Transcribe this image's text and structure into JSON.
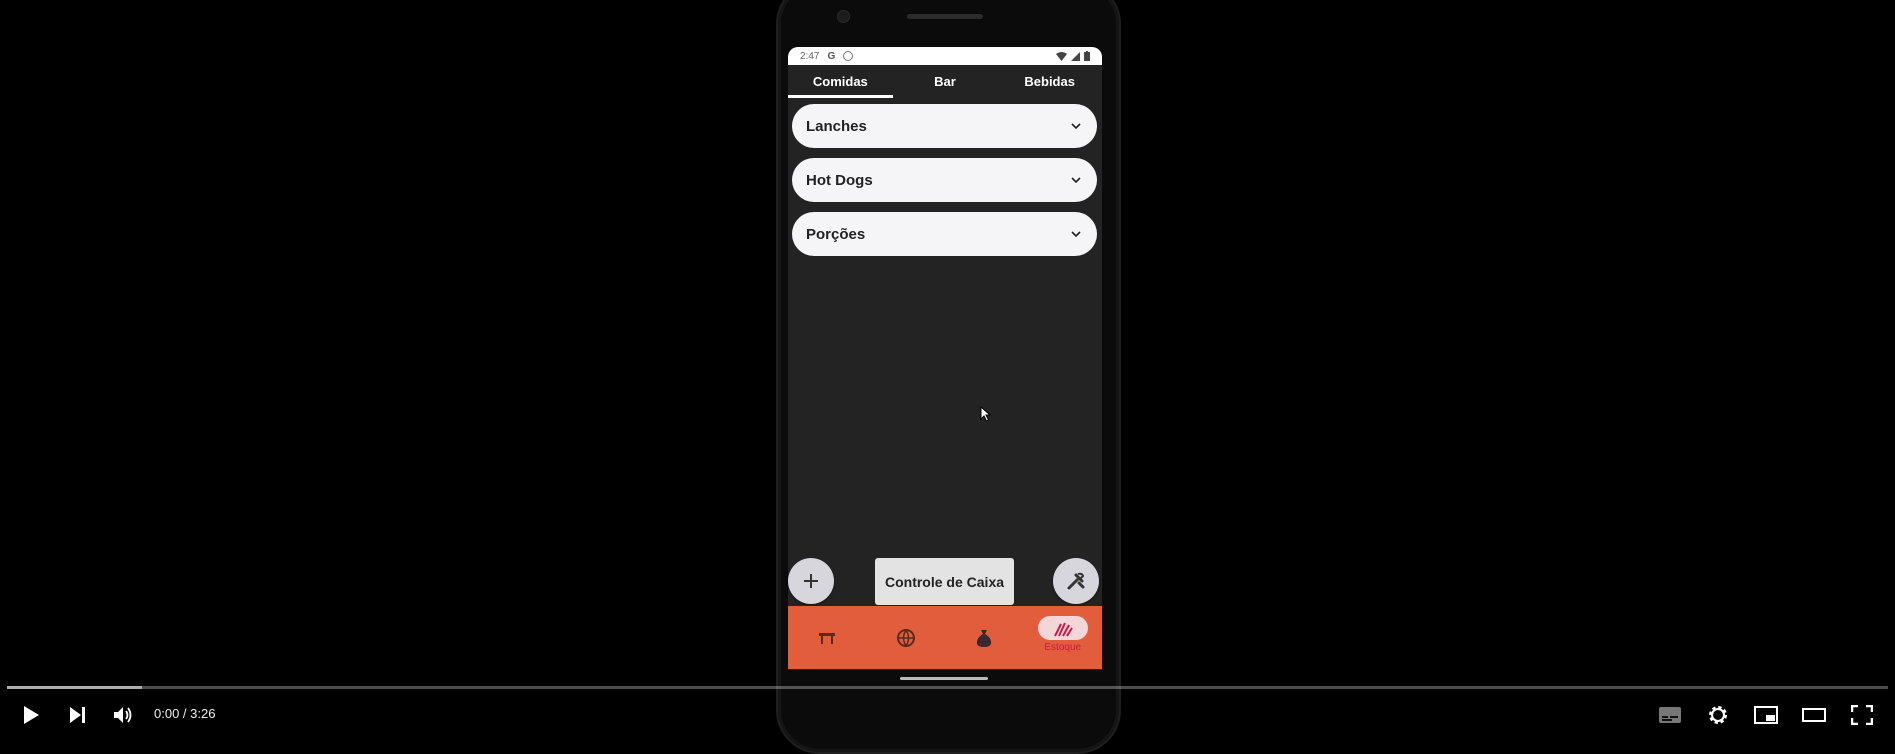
{
  "status_bar": {
    "time": "2:47",
    "g_icon": "google-g-icon",
    "notif_icon": "notification-icon"
  },
  "tabs": [
    {
      "label": "Comidas",
      "active": true
    },
    {
      "label": "Bar",
      "active": false
    },
    {
      "label": "Bebidas",
      "active": false
    }
  ],
  "categories": [
    {
      "label": "Lanches"
    },
    {
      "label": "Hot Dogs"
    },
    {
      "label": "Porções"
    }
  ],
  "actions": {
    "add_icon": "plus-icon",
    "cash_control_label": "Controle de Caixa",
    "tools_icon": "tools-icon"
  },
  "bottom_nav": {
    "items": [
      {
        "icon": "table-icon",
        "label": ""
      },
      {
        "icon": "globe-icon",
        "label": ""
      },
      {
        "icon": "money-bag-icon",
        "label": ""
      },
      {
        "icon": "stock-icon",
        "label": "Estoque",
        "active": true
      }
    ],
    "accent": "#e25d3c",
    "active_label_color": "#c81a4d"
  },
  "player": {
    "time": "0:00 / 3:26",
    "progress_fraction": 0.0,
    "loaded_fraction": 0.072
  }
}
